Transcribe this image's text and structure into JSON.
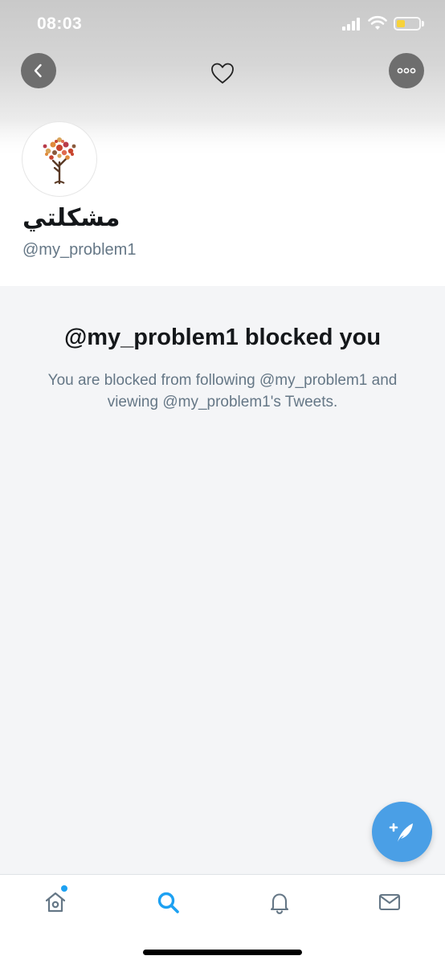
{
  "status_bar": {
    "time": "08:03",
    "battery_level": 0.4,
    "battery_color": "#f7d23a"
  },
  "nav": {
    "back_icon": "chevron-left-icon",
    "favorite_icon": "heart-outline-icon",
    "more_icon": "more-horizontal-icon"
  },
  "profile": {
    "display_name": "مشكلتي",
    "handle": "@my_problem1",
    "avatar_icon": "tree-illustration"
  },
  "blocked": {
    "title": "@my_problem1 blocked you",
    "description": "You are blocked from following @my_problem1 and viewing @my_problem1's Tweets."
  },
  "fab": {
    "icon": "compose-tweet-icon",
    "color": "#4a9fe6"
  },
  "tab_bar": {
    "items": [
      {
        "name": "home",
        "icon": "home-icon",
        "active": false,
        "has_badge": true
      },
      {
        "name": "search",
        "icon": "search-icon",
        "active": true
      },
      {
        "name": "notifications",
        "icon": "bell-icon",
        "active": false
      },
      {
        "name": "messages",
        "icon": "envelope-icon",
        "active": false
      }
    ],
    "active_color": "#1da1f2",
    "inactive_color": "#657786"
  }
}
